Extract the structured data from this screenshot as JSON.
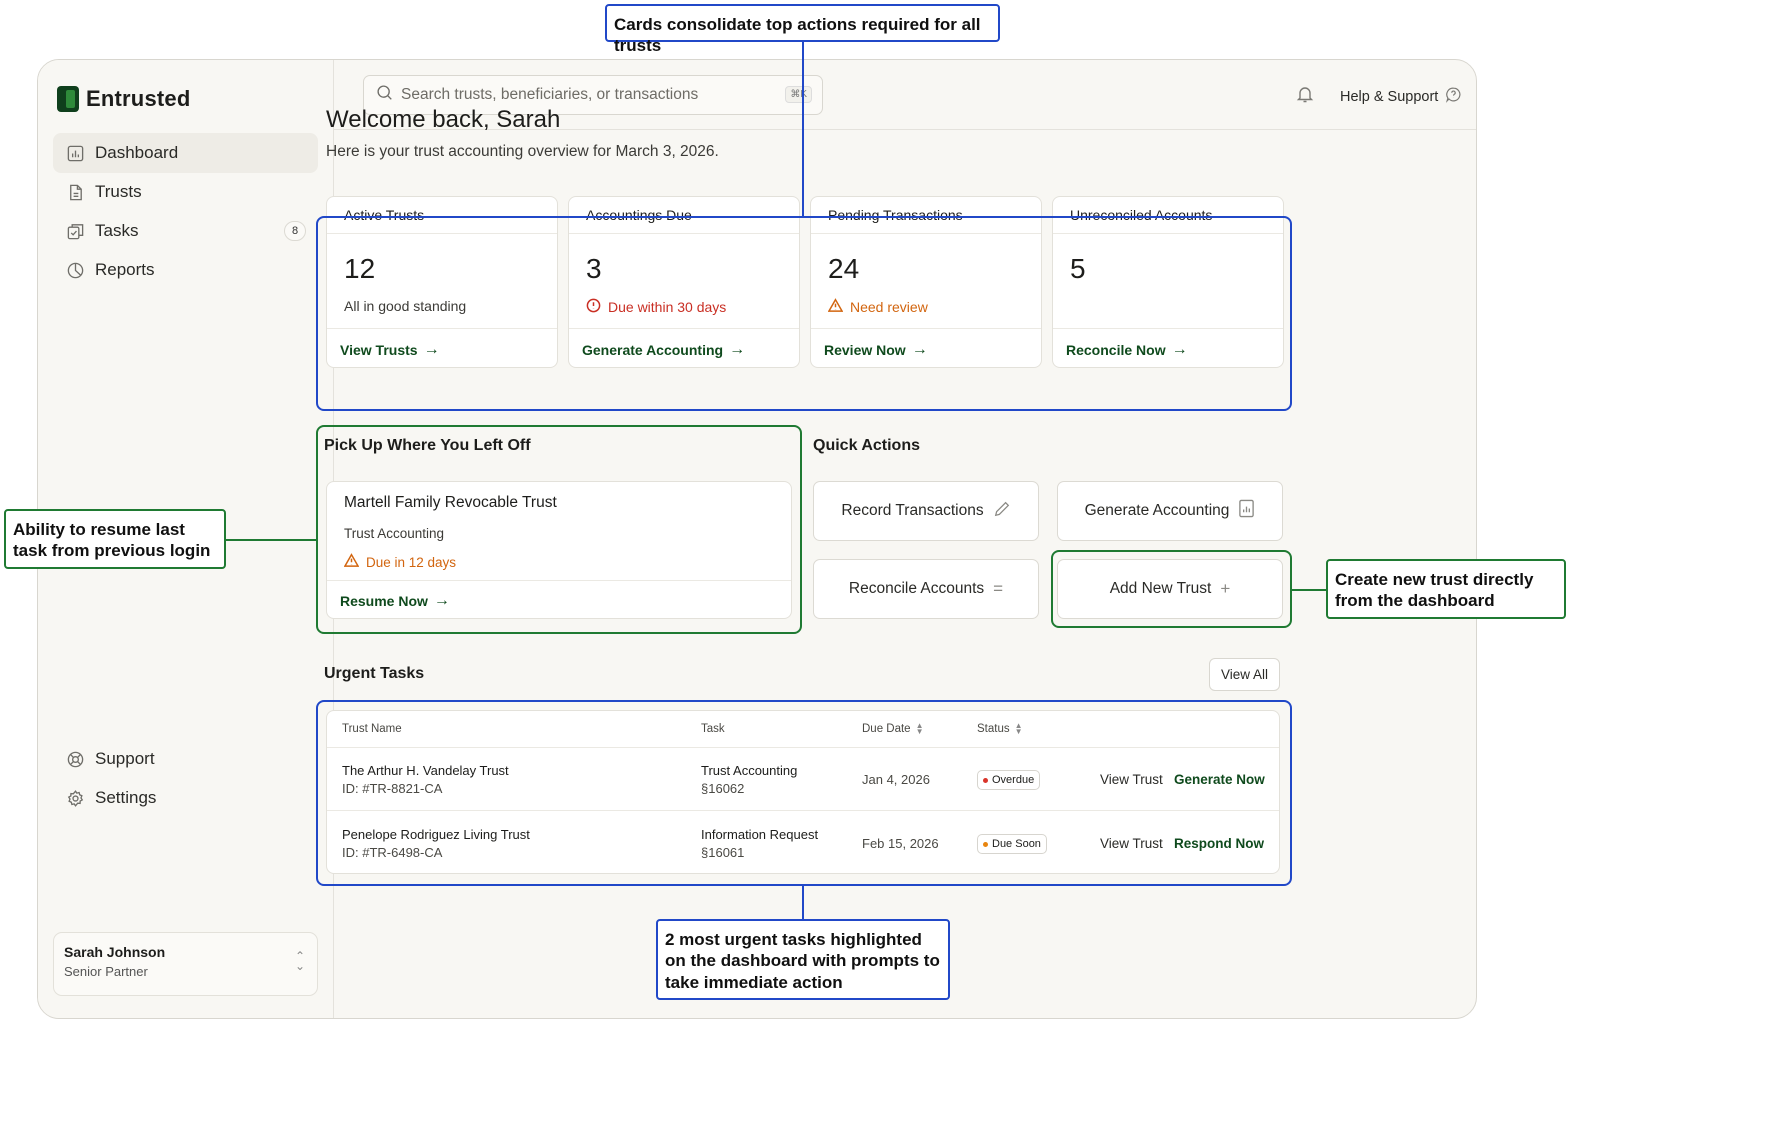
{
  "app": {
    "name": "Entrusted"
  },
  "sidebar": {
    "items": [
      {
        "label": "Dashboard"
      },
      {
        "label": "Trusts"
      },
      {
        "label": "Tasks",
        "badge": "8"
      },
      {
        "label": "Reports"
      }
    ],
    "bottom": [
      {
        "label": "Support"
      },
      {
        "label": "Settings"
      }
    ],
    "user": {
      "name": "Sarah Johnson",
      "role": "Senior Partner"
    }
  },
  "topbar": {
    "search_placeholder": "Search trusts, beneficiaries, or transactions",
    "search_shortcut": "⌘K",
    "help_label": "Help & Support"
  },
  "header": {
    "welcome": "Welcome back, Sarah",
    "subtitle": "Here is your trust accounting overview for March 3, 2026."
  },
  "stats": [
    {
      "title": "Active Trusts",
      "value": "12",
      "note": "All in good standing",
      "link": "View Trusts"
    },
    {
      "title": "Accountings Due",
      "value": "3",
      "note": "Due within 30 days",
      "link": "Generate Accounting"
    },
    {
      "title": "Pending Transactions",
      "value": "24",
      "note": "Need review",
      "link": "Review Now"
    },
    {
      "title": "Unreconciled Accounts",
      "value": "5",
      "note": "",
      "link": "Reconcile Now"
    }
  ],
  "pickup": {
    "title": "Pick Up Where You Left Off",
    "trust_name": "Martell Family Revocable Trust",
    "task_type": "Trust Accounting",
    "due": "Due in 12 days",
    "link": "Resume Now"
  },
  "quick_actions": {
    "title": "Quick Actions",
    "buttons": [
      "Record Transactions",
      "Generate Accounting",
      "Reconcile Accounts",
      "Add New Trust"
    ]
  },
  "urgent": {
    "title": "Urgent Tasks",
    "view_all": "View All",
    "columns": [
      "Trust Name",
      "Task",
      "Due Date",
      "Status"
    ],
    "rows": [
      {
        "trust": "The Arthur H. Vandelay Trust",
        "id": "ID: #TR-8821-CA",
        "task": "Trust Accounting",
        "code": "§16062",
        "due": "Jan 4, 2026",
        "status": "Overdue",
        "view": "View Trust",
        "action": "Generate Now"
      },
      {
        "trust": "Penelope Rodriguez Living Trust",
        "id": "ID: #TR-6498-CA",
        "task": "Information Request",
        "code": "§16061",
        "due": "Feb 15, 2026",
        "status": "Due Soon",
        "view": "View Trust",
        "action": "Respond Now"
      }
    ]
  },
  "annotations": {
    "top": "Cards consolidate top actions required for all trusts",
    "left": "Ability to resume last task from previous login",
    "right": "Create new trust directly from the dashboard",
    "bottom": "2 most urgent tasks highlighted on the dashboard with prompts to take immediate action"
  },
  "colors": {
    "brand": "#0f3f1c",
    "annotation_blue": "#2148c8",
    "annotation_green": "#1f7a32",
    "alert_red": "#c92f24",
    "alert_orange": "#d2650f"
  }
}
